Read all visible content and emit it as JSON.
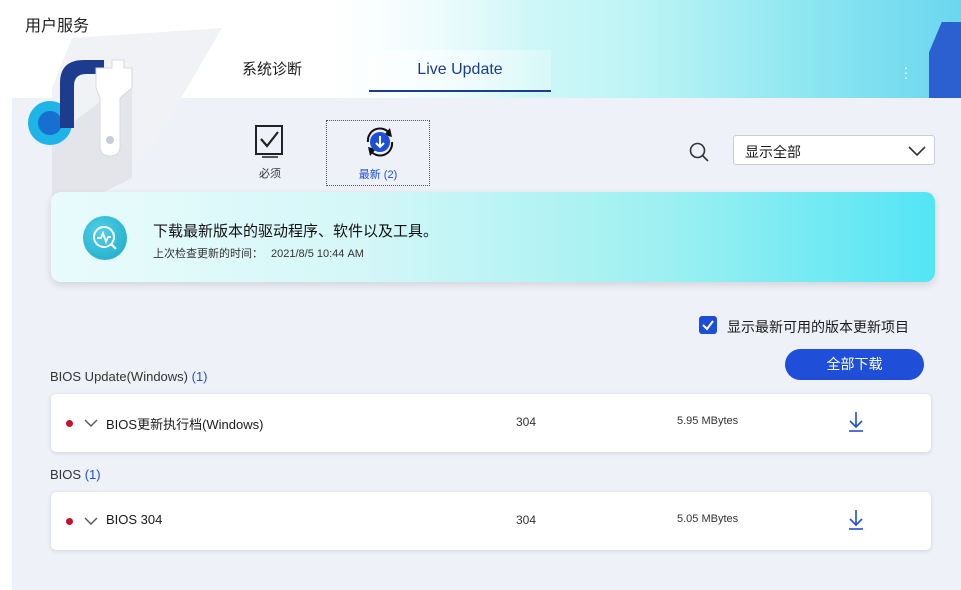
{
  "app": {
    "title": "用户服务"
  },
  "tabs": [
    {
      "label": "系统诊断",
      "active": false
    },
    {
      "label": "Live Update",
      "active": true
    }
  ],
  "categories": [
    {
      "label": "必须",
      "icon": "checkbox-doc-icon",
      "selected": false
    },
    {
      "label": "最新 (2)",
      "icon": "refresh-download-icon",
      "selected": true
    }
  ],
  "filter": {
    "selected": "显示全部"
  },
  "banner": {
    "title": "下载最新版本的驱动程序、软件以及工具。",
    "last_check_label": "上次检查更新的时间：",
    "last_check_time": "2021/8/5  10:44 AM"
  },
  "show_latest": {
    "label": "显示最新可用的版本更新项目",
    "checked": true
  },
  "download_all": {
    "label": "全部下载"
  },
  "sections": [
    {
      "name": "BIOS Update(Windows)",
      "count": "(1)",
      "items": [
        {
          "name": "BIOS更新执行档(Windows)",
          "version": "304",
          "size": "5.95 MBytes"
        }
      ]
    },
    {
      "name": "BIOS",
      "count": "(1)",
      "items": [
        {
          "name": "BIOS 304",
          "version": "304",
          "size": "5.05 MBytes"
        }
      ]
    }
  ],
  "colors": {
    "accent": "#1f4fd8",
    "tab_active": "#1d3c8e",
    "status_dot": "#c8102e",
    "banner_end": "#53e5f4"
  }
}
